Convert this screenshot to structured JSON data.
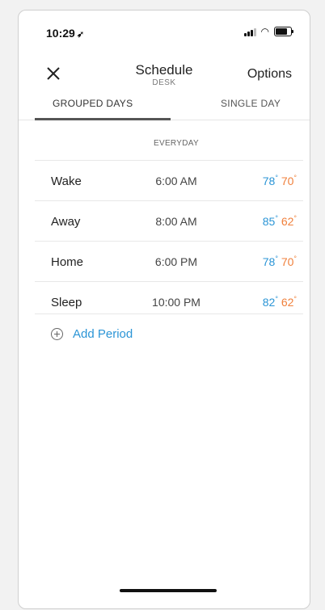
{
  "status_bar": {
    "time": "10:29",
    "location_icon": "location-arrow-icon",
    "signal_icon": "signal-icon",
    "wifi_icon": "wifi-icon",
    "battery_icon": "battery-icon"
  },
  "header": {
    "close_icon": "close-icon",
    "title": "Schedule",
    "subtitle": "DESK",
    "options_label": "Options"
  },
  "tabs": [
    {
      "label": "GROUPED DAYS",
      "active": true
    },
    {
      "label": "SINGLE DAY",
      "active": false
    }
  ],
  "column_header": "EVERYDAY",
  "periods": [
    {
      "name": "Wake",
      "time": "6:00 AM",
      "cool": "78",
      "heat": "70"
    },
    {
      "name": "Away",
      "time": "8:00 AM",
      "cool": "85",
      "heat": "62"
    },
    {
      "name": "Home",
      "time": "6:00 PM",
      "cool": "78",
      "heat": "70"
    },
    {
      "name": "Sleep",
      "time": "10:00 PM",
      "cool": "82",
      "heat": "62"
    }
  ],
  "degree_symbol": "°",
  "add_period": {
    "label": "Add Period",
    "icon": "plus-circle-icon"
  },
  "colors": {
    "cool": "#2b95d6",
    "heat": "#f0803c",
    "link": "#2b95d6"
  }
}
